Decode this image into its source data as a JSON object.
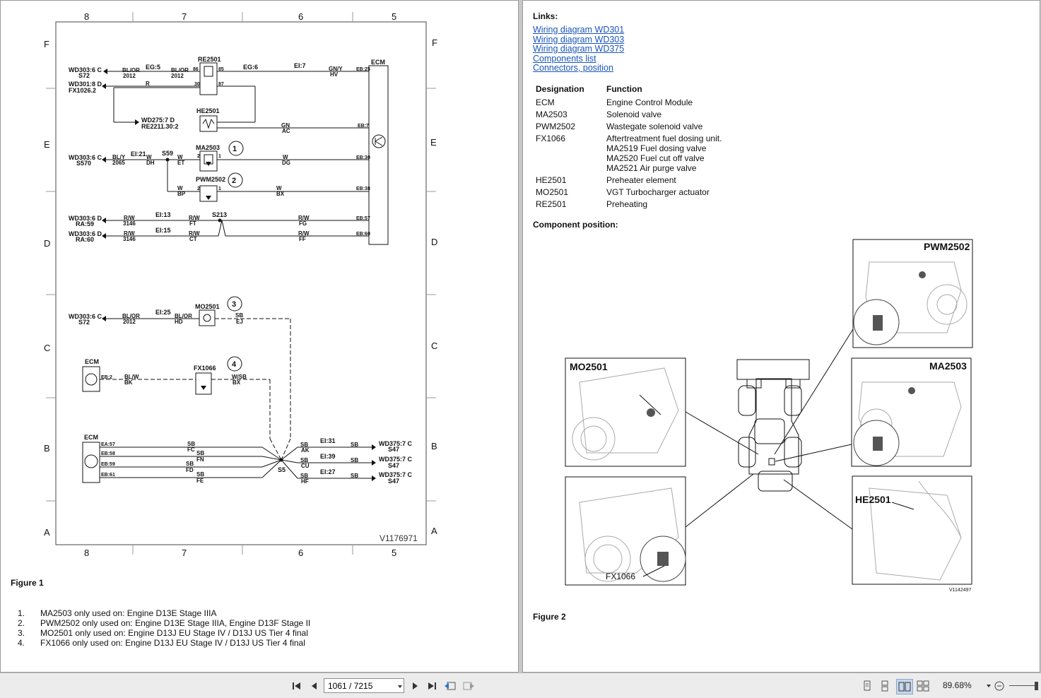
{
  "left_page": {
    "diagram": {
      "column_labels_top": [
        "8",
        "7",
        "6",
        "5"
      ],
      "column_labels_bottom": [
        "8",
        "7",
        "6",
        "5"
      ],
      "row_labels_left": [
        "F",
        "E",
        "D",
        "C",
        "B",
        "A"
      ],
      "row_labels_right": [
        "F",
        "E",
        "D",
        "C",
        "B",
        "A"
      ],
      "ref_code": "V1176971",
      "labels": {
        "re2501": "RE2501",
        "ecm": "ECM",
        "he2501": "HE2501",
        "ma2503": "MA2503",
        "pwm2502": "PWM2502",
        "s59": "S59",
        "s213": "S213",
        "mo2501": "MO2501",
        "fx1066": "FX1066",
        "s5": "S5",
        "wd303_c_s72_a": "WD303:6 C",
        "s72_a": "S72",
        "wd301_d": "WD301:8 D",
        "fx1026": "FX1026.2",
        "wd275": "WD275:7 D",
        "re2211": "RE2211.30:2",
        "wd303_c_s570": "WD303:6 C",
        "s570": "S570",
        "wd303_d_ra59": "WD303:6 D",
        "ra59": "RA:59",
        "wd303_d_ra60": "WD303:6 D",
        "ra60": "RA:60",
        "wd303_c_s72_b": "WD303:6 C",
        "s72_b": "S72",
        "wd375_1": "WD375:7 C",
        "s47_1": "S47",
        "wd375_2": "WD375:7 C",
        "s47_2": "S47",
        "wd375_3": "WD375:7 C",
        "s47_3": "S47",
        "bl_or_1": "BL/OR",
        "n2012_1": "2012",
        "eg5": "EG:5",
        "bl_or_2": "BL/OR",
        "n2012_2": "2012",
        "eg6": "EG:6",
        "ei7": "EI:7",
        "gn_y": "GN/Y",
        "hv": "HV",
        "eb25": "EB:25",
        "r_1": "R",
        "n86": "86",
        "n85": "85",
        "n30": "30",
        "n87": "87",
        "gn": "GN",
        "ac": "AC",
        "eb7": "EB:7",
        "bl_y": "BL/Y",
        "n2065": "2065",
        "ei21": "EI:21",
        "w_1": "W",
        "dh": "DH",
        "w_2": "W",
        "et": "ET",
        "n2_a": "2",
        "n1_a": "1",
        "w_3": "W",
        "dg": "DG",
        "eb30": "EB:30",
        "w_4": "W",
        "bp": "BP",
        "n2_b": "2",
        "n1_b": "1",
        "w_5": "W",
        "bx_1": "BX",
        "eb38": "EB:38",
        "rw_1": "R/W",
        "n3146_1": "3146",
        "ei13": "EI:13",
        "rw_2": "R/W",
        "ft": "FT",
        "rw_3": "R/W",
        "fg": "FG",
        "eb57": "EB:57",
        "rw_4": "R/W",
        "n3146_2": "3146",
        "ei15": "EI:15",
        "rw_5": "R/W",
        "ct": "CT",
        "rw_6": "R/W",
        "ff": "FF",
        "eb60": "EB:60",
        "bl_or_3": "BL/OR",
        "n2012_3": "2012",
        "ei25": "EI:25",
        "bl_or_4": "BL/OR",
        "hd": "HD",
        "sb_1": "SB",
        "ej": "EJ",
        "eb2": "EB:2",
        "bl_w": "BL/W",
        "bk": "BK",
        "w_sb": "W/SB",
        "bx_2": "BX",
        "ea57": "EA:57",
        "eb58": "EB:58",
        "eb59": "EB:59",
        "eb61": "EB:61",
        "sb_2": "SB",
        "fc": "FC",
        "sb_3": "SB",
        "fn": "FN",
        "sb_4": "SB",
        "fd": "FD",
        "sb_5": "SB",
        "fe": "FE",
        "sb_6": "SB",
        "ak": "AK",
        "ei31": "EI:31",
        "sb_7": "SB",
        "sb_8": "SB",
        "cu": "CU",
        "ei39": "EI:39",
        "sb_9": "SB",
        "sb_10": "SB",
        "hf": "HF",
        "ei27": "EI:27",
        "sb_11": "SB",
        "c1": "1",
        "c2": "2",
        "c3": "3",
        "c4": "4"
      }
    },
    "figure_title": "Figure 1",
    "notes": [
      {
        "num": "1.",
        "text": "MA2503 only used on: Engine D13E Stage IIIA"
      },
      {
        "num": "2.",
        "text": "PWM2502 only used on: Engine D13E Stage IIIA, Engine D13F Stage II"
      },
      {
        "num": "3.",
        "text": "MO2501 only used on: Engine D13J EU Stage IV / D13J US Tier 4 final"
      },
      {
        "num": "4.",
        "text": "FX1066 only used on: Engine D13J EU Stage IV / D13J US Tier 4 final"
      }
    ]
  },
  "right_page": {
    "links_heading": "Links:",
    "links": [
      "Wiring diagram WD301",
      "Wiring diagram WD303",
      "Wiring diagram WD375",
      "Components list",
      "Connectors, position"
    ],
    "table": {
      "headers": [
        "Designation",
        "Function"
      ],
      "rows": [
        {
          "designation": "ECM",
          "function": [
            "Engine Control Module"
          ]
        },
        {
          "designation": "MA2503",
          "function": [
            "Solenoid valve"
          ]
        },
        {
          "designation": "PWM2502",
          "function": [
            "Wastegate solenoid valve"
          ]
        },
        {
          "designation": "FX1066",
          "function": [
            "Aftertreatment fuel dosing unit.",
            "MA2519 Fuel dosing valve",
            "MA2520 Fuel cut off valve",
            "MA2521 Air purge valve"
          ]
        },
        {
          "designation": "HE2501",
          "function": [
            "Preheater element"
          ]
        },
        {
          "designation": "MO2501",
          "function": [
            "VGT Turbocharger actuator"
          ]
        },
        {
          "designation": "RE2501",
          "function": [
            "Preheating"
          ]
        }
      ]
    },
    "component_position_heading": "Component position:",
    "photo_labels": {
      "pwm2502": "PWM2502",
      "ma2503": "MA2503",
      "mo2501": "MO2501",
      "he2501": "HE2501",
      "fx1066": "FX1066",
      "ref_code": "V1142497"
    },
    "figure_title": "Figure 2"
  },
  "toolbar": {
    "page_input_value": "1061 / 7215",
    "zoom_level": "89.68%",
    "first_page_icon": "first-page-icon",
    "prev_page_icon": "prev-page-icon",
    "next_page_icon": "next-page-icon",
    "last_page_icon": "last-page-icon",
    "colors": {
      "bar": "#ececec",
      "link": "#1a55b8"
    }
  }
}
